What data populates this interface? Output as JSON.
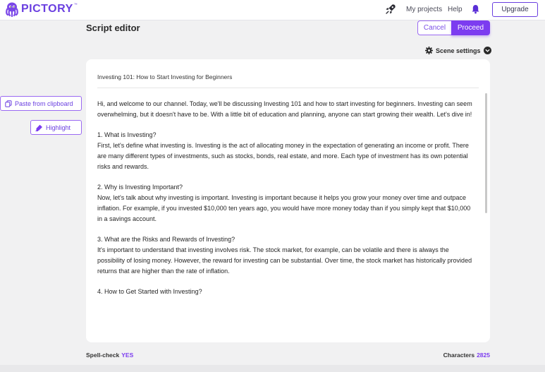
{
  "header": {
    "brand": "PICTORY",
    "brand_tm": "™",
    "nav": {
      "my_projects": "My projects",
      "help": "Help"
    },
    "upgrade_label": "Upgrade"
  },
  "page": {
    "title": "Script editor"
  },
  "actions": {
    "cancel": "Cancel",
    "proceed": "Proceed"
  },
  "scene_settings": {
    "label": "Scene settings"
  },
  "sidebar": {
    "paste_label": "Paste from clipboard",
    "highlight_label": "Highlight"
  },
  "editor": {
    "title": "Investing 101: How to Start Investing for Beginners",
    "paragraphs": [
      {
        "heading": "",
        "text": "Hi, and welcome to our channel. Today, we'll be discussing Investing 101 and how to start investing for beginners. Investing can seem overwhelming, but it doesn't have to be. With a little bit of education and planning, anyone can start growing their wealth. Let's dive in!"
      },
      {
        "heading": "1. What is Investing?",
        "text": "First, let's define what investing is. Investing is the act of allocating money in the expectation of generating an income or profit. There are many different types of investments, such as stocks, bonds, real estate, and more. Each type of investment has its own potential risks and rewards."
      },
      {
        "heading": "2. Why is Investing Important?",
        "text": "Now, let's talk about why investing is important. Investing is important because it helps you grow your money over time and outpace inflation. For example, if you invested $10,000 ten years ago, you would have more money today than if you simply kept that $10,000 in a savings account."
      },
      {
        "heading": "3. What are the Risks and Rewards of Investing?",
        "text": "It's important to understand that investing involves risk. The stock market, for example, can be volatile and there is always the possibility of losing money. However, the reward for investing can be substantial. Over time, the stock market has historically provided returns that are higher than the rate of inflation."
      },
      {
        "heading": "4. How to Get Started with Investing?",
        "text": ""
      }
    ]
  },
  "footer": {
    "spellcheck_label": "Spell-check",
    "spellcheck_value": "YES",
    "characters_label": "Characters",
    "characters_value": "2825"
  },
  "colors": {
    "accent": "#7c3cf0",
    "brand": "#6a3fe0",
    "background": "#f1f1f2"
  },
  "icons": {
    "logo": "octopus-logo-icon",
    "rocket": "rocket-icon",
    "bell": "bell-icon",
    "gear": "gear-icon",
    "chevron": "chevron-down-icon",
    "paste": "copy-icon",
    "highlight": "highlighter-icon"
  }
}
